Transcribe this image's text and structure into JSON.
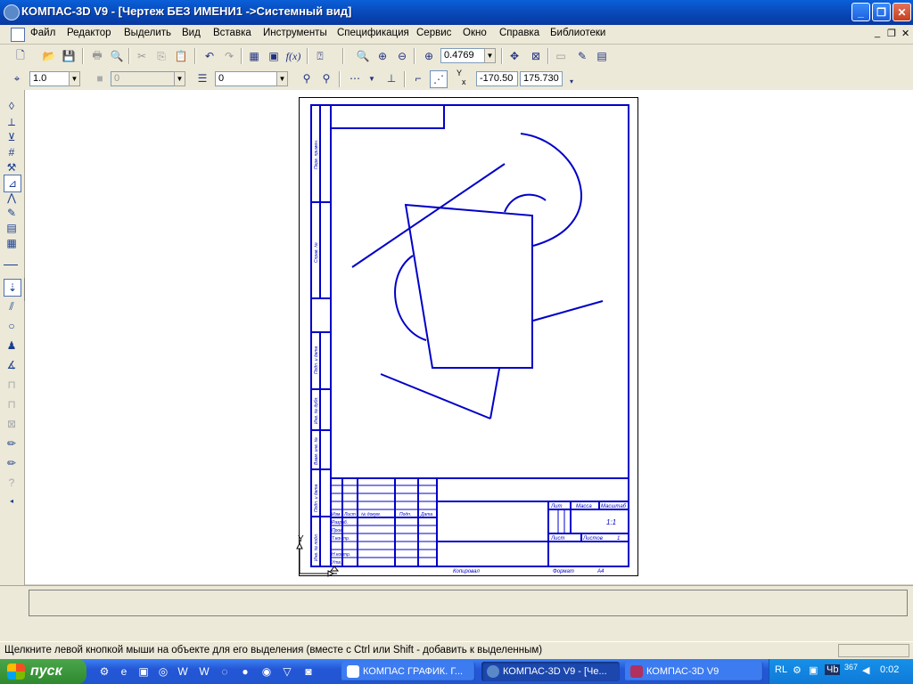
{
  "window": {
    "title": "КОМПАС-3D V9 - [Чертеж БЕЗ ИМЕНИ1 ->Системный вид]",
    "btn_minimize": "_",
    "btn_maximize": "❐",
    "btn_close": "✕"
  },
  "menu": {
    "items": [
      "Файл",
      "Редактор",
      "Выделить",
      "Вид",
      "Вставка",
      "Инструменты",
      "Спецификация",
      "Сервис",
      "Окно",
      "Справка",
      "Библиотеки"
    ],
    "mdi_min": "_",
    "mdi_restore": "❐",
    "mdi_close": "✕"
  },
  "toolbar1": {
    "zoom_value": "0.4769",
    "fx_label": "f(x)"
  },
  "toolbar2": {
    "line_scale": "1.0",
    "layer_state": "0",
    "layer_value": "0",
    "coord_x": "-170.50",
    "coord_y": "175.730",
    "coord_label_y": "Y",
    "coord_label_x": "x"
  },
  "drawing": {
    "stamp_labels": {
      "lit": "Лит",
      "massa": "Масса",
      "masshtab": "Масштаб",
      "scale": "1:1",
      "list": "Лист",
      "listov": "Листов",
      "listov_val": "1",
      "izm": "Изм.",
      "list_col": "Лист",
      "ndokum": "№ докум.",
      "podp": "Подп.",
      "data": "Дата",
      "razrab": "Разраб.",
      "prov": "Пров.",
      "tkontr": "Т.контр.",
      "nkontr": "Н.контр.",
      "utv": "Утв.",
      "kopiroval": "Копировал",
      "format": "Формат",
      "format_val": "А4"
    },
    "side_labels": {
      "perv_primen": "Перв. примен.",
      "sprav": "Справ. №",
      "podp_data1": "Подп. и дата",
      "inv_dubl": "Инв. № дубл.",
      "vzam_inv": "Взам. инв. №",
      "podp_data2": "Подп. и дата",
      "inv_podl": "Инв. № подл."
    },
    "axis_y": "Y"
  },
  "status": {
    "text": "Щелкните левой кнопкой мыши на объекте для его выделения (вместе с Ctrl или Shift - добавить к выделенным)"
  },
  "taskbar": {
    "start_label": "пуск",
    "tasks": [
      "КОМПАС ГРАФИК. Г...",
      "КОМПАС-3D V9 - [Че...",
      "КОМПАС-3D V9"
    ],
    "tray_lang": "RL",
    "tray_time": "0:02",
    "tray_kb": "Чb",
    "tray_num": "367"
  },
  "colors": {
    "drawing_blue": "#0000c8",
    "titlebar": "#0846b4",
    "taskbar": "#2457d6"
  }
}
